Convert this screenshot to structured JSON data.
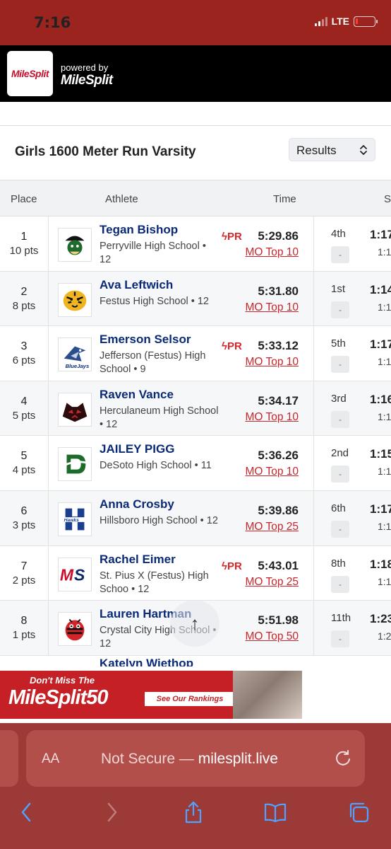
{
  "status": {
    "time": "7:16",
    "network": "LTE"
  },
  "header": {
    "logo": "MileSplit",
    "powered_by": "powered by",
    "brand": "MileSplit"
  },
  "event": {
    "title": "Girls 1600 Meter Run Varsity",
    "view_selector": "Results"
  },
  "table": {
    "headers": {
      "place": "Place",
      "athlete": "Athlete",
      "time": "Time",
      "splits": "S"
    },
    "rows": [
      {
        "place": "1",
        "pts": "10 pts",
        "name": "Tegan Bishop",
        "school": "Perryville High School • 12",
        "pr": "PR",
        "time": "5:29.86",
        "rank_link": "MO Top 10",
        "split_rank": "4th",
        "split_badge": "-",
        "split_time": "1:17",
        "split_sub": "1:1",
        "logo": "pirate-logo"
      },
      {
        "place": "2",
        "pts": "8 pts",
        "name": "Ava Leftwich",
        "school": "Festus High School • 12",
        "pr": "",
        "time": "5:31.80",
        "rank_link": "MO Top 10",
        "split_rank": "1st",
        "split_badge": "-",
        "split_time": "1:14",
        "split_sub": "1:1",
        "logo": "tiger-logo"
      },
      {
        "place": "3",
        "pts": "6 pts",
        "name": "Emerson Selsor",
        "school": "Jefferson (Festus) High School • 9",
        "pr": "PR",
        "time": "5:33.12",
        "rank_link": "MO Top 10",
        "split_rank": "5th",
        "split_badge": "-",
        "split_time": "1:17",
        "split_sub": "1:1",
        "logo": "bluejay-logo"
      },
      {
        "place": "4",
        "pts": "5 pts",
        "name": "Raven Vance",
        "school": "Herculaneum High School • 12",
        "pr": "",
        "time": "5:34.17",
        "rank_link": "MO Top 10",
        "split_rank": "3rd",
        "split_badge": "-",
        "split_time": "1:16",
        "split_sub": "1:1",
        "logo": "panther-logo"
      },
      {
        "place": "5",
        "pts": "4 pts",
        "name": "JAILEY PIGG",
        "school": "DeSoto High School • 11",
        "pr": "",
        "time": "5:36.26",
        "rank_link": "MO Top 10",
        "split_rank": "2nd",
        "split_badge": "-",
        "split_time": "1:15",
        "split_sub": "1:1",
        "logo": "desoto-logo"
      },
      {
        "place": "6",
        "pts": "3 pts",
        "name": "Anna Crosby",
        "school": "Hillsboro High School • 12",
        "pr": "",
        "time": "5:39.86",
        "rank_link": "MO Top 25",
        "split_rank": "6th",
        "split_badge": "-",
        "split_time": "1:17",
        "split_sub": "1:1",
        "logo": "hawks-logo"
      },
      {
        "place": "7",
        "pts": "2 pts",
        "name": "Rachel Eimer",
        "school": "St. Pius X (Festus) High Schoo • 12",
        "pr": "PR",
        "time": "5:43.01",
        "rank_link": "MO Top 25",
        "split_rank": "8th",
        "split_badge": "-",
        "split_time": "1:18",
        "split_sub": "1:1",
        "logo": "ms-logo"
      },
      {
        "place": "8",
        "pts": "1 pts",
        "name": "Lauren Hartman",
        "school": "Crystal City High School • 12",
        "pr": "",
        "time": "5:51.98",
        "rank_link": "MO Top 50",
        "split_rank": "11th",
        "split_badge": "-",
        "split_time": "1:23",
        "split_sub": "1:2",
        "logo": "hornet-logo"
      }
    ],
    "peek_name": "Katelyn Wiethop"
  },
  "ad": {
    "tagline": "Don't Miss The",
    "brand": "MileSplit50",
    "cta": "See Our Rankings"
  },
  "browser": {
    "aa": "AA",
    "url_prefix": "Not Secure — ",
    "url_domain": "milesplit.live"
  },
  "colors": {
    "brand_red": "#9b241f",
    "link_red": "#c8262b",
    "name_blue": "#0a2a78"
  }
}
